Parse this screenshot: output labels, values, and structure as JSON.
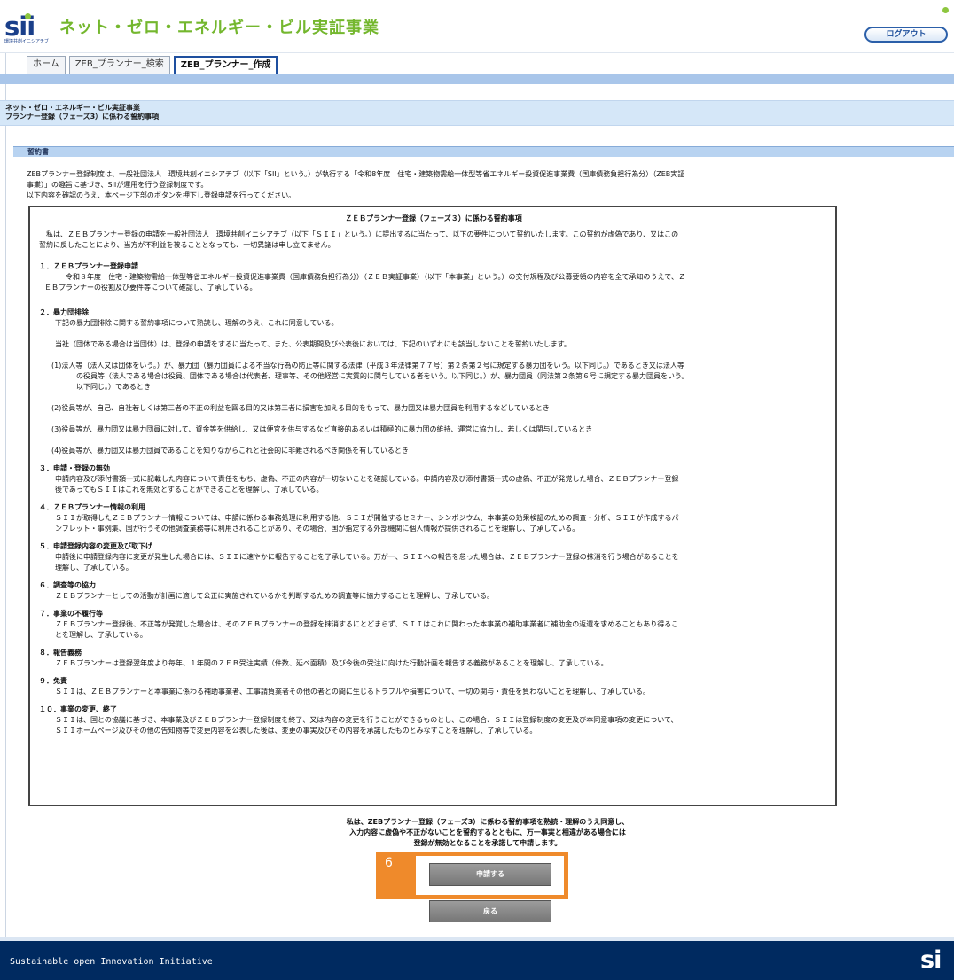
{
  "header": {
    "logo_text": "sii",
    "logo_sub": "環境共創イニシアチブ",
    "site_title": "ネット・ゼロ・エネルギー・ビル実証事業",
    "logout_label": "ログアウト",
    "colors": {
      "logo": "#1a3f8a",
      "title": "#74b72e",
      "accent": "#2b5fa9"
    }
  },
  "tabs": [
    {
      "label": "ホーム",
      "active": false
    },
    {
      "label": "ZEB_プランナー_検索",
      "active": false
    },
    {
      "label": "ZEB_プランナー_作成",
      "active": true
    }
  ],
  "page_title": {
    "line1": "ネット・ゼロ・エネルギー・ビル実証事業",
    "line2": "プランナー登録（フェーズ3）に係わる誓約事項"
  },
  "oath_header": "誓約書",
  "intro": {
    "line1": "ZEBプランナー登録制度は、一般社団法人　環境共創イニシアチブ（以下「SII」という。）が執行する「令和8年度　住宅・建築物需給一体型等省エネルギー投資促進事業費（国庫債務負担行為分）（ZEB実証",
    "line2": "事業）」の趣旨に基づき、SIIが運用を行う登録制度です。",
    "line3": "以下内容を確認のうえ、本ページ下部のボタンを押下し登録申請を行ってください。"
  },
  "terms": {
    "title": "ＺＥＢプランナー登録（フェーズ３）に係わる誓約事項",
    "preamble": [
      "　私は、ＺＥＢプランナー登録の申請を一般社団法人　環境共創イニシアチブ（以下「ＳＩＩ」という。）に提出するに当たって、以下の要件について誓約いたします。この誓約が虚偽であり、又はこの",
      "誓約に反したことにより、当方が不利益を被ることとなっても、一切異議は申し立てません。"
    ],
    "s1_head": "１．ＺＥＢプランナー登録申請",
    "s1_body": [
      "令和８年度　住宅・建築物需給一体型等省エネルギー投資促進事業費（国庫債務負担行為分）（ＺＥＢ実証事業）（以下「本事業」という。）の交付規程及び公募要領の内容を全て承知のうえで、Ｚ",
      "ＥＢプランナーの役割及び要件等について確認し、了承している。"
    ],
    "s2_head": "２．暴力団排除",
    "s2_body1": "下記の暴力団排除に関する誓約事項について熟読し、理解のうえ、これに同意している。",
    "s2_body2": "当社（団体である場合は当団体）は、登録の申請をするに当たって、また、公表期間及び公表後においては、下記のいずれにも該当しないことを誓約いたします。",
    "s2_item1": [
      "(1)法人等（法人又は団体をいう。）が、暴力団（暴力団員による不当な行為の防止等に関する法律（平成３年法律第７７号）第２条第２号に規定する暴力団をいう。以下同じ。）であるとき又は法人等",
      "の役員等（法人である場合は役員、団体である場合は代表者、理事等、その他経営に実質的に関与している者をいう。以下同じ。）が、暴力団員（同法第２条第６号に規定する暴力団員をいう。",
      "以下同じ。）であるとき"
    ],
    "s2_item2": "(2)役員等が、自己、自社若しくは第三者の不正の利益を図る目的又は第三者に損害を加える目的をもって、暴力団又は暴力団員を利用するなどしているとき",
    "s2_item3": "(3)役員等が、暴力団又は暴力団員に対して、資金等を供給し、又は便宜を供与するなど直接的あるいは積極的に暴力団の維持、運営に協力し、若しくは関与しているとき",
    "s2_item4": "(4)役員等が、暴力団又は暴力団員であることを知りながらこれと社会的に非難されるべき関係を有しているとき",
    "s3_head": "３．申請・登録の無効",
    "s3_body": [
      "申請内容及び添付書類一式に記載した内容について責任をもち、虚偽、不正の内容が一切ないことを確認している。申請内容及び添付書類一式の虚偽、不正が発覚した場合、ＺＥＢプランナー登録",
      "後であってもＳＩＩはこれを無効とすることができることを理解し、了承している。"
    ],
    "s4_head": "４．ＺＥＢプランナー情報の利用",
    "s4_body": [
      "ＳＩＩが取得したＺＥＢプランナー情報については、申請に係わる事務処理に利用する他、ＳＩＩが開催するセミナー、シンポジウム、本事業の効果検証のための調査・分析、ＳＩＩが作成するパ",
      "ンフレット・事例集、国が行うその他調査業務等に利用されることがあり、その場合、国が指定する外部機関に個人情報が提供されることを理解し、了承している。"
    ],
    "s5_head": "５．申請登録内容の変更及び取下げ",
    "s5_body": [
      "申請後に申請登録内容に変更が発生した場合には、ＳＩＩに速やかに報告することを了承している。万が一、ＳＩＩへの報告を怠った場合は、ＺＥＢプランナー登録の抹消を行う場合があることを",
      "理解し、了承している。"
    ],
    "s6_head": "６．調査等の協力",
    "s6_body": "ＺＥＢプランナーとしての活動が計画に適して公正に実施されているかを判断するための調査等に協力することを理解し、了承している。",
    "s7_head": "７．事業の不履行等",
    "s7_body": [
      "ＺＥＢプランナー登録後、不正等が発覚した場合は、そのＺＥＢプランナーの登録を抹消するにとどまらず、ＳＩＩはこれに関わった本事業の補助事業者に補助金の返還を求めることもあり得るこ",
      "とを理解し、了承している。"
    ],
    "s8_head": "８．報告義務",
    "s8_body": "ＺＥＢプランナーは登録翌年度より毎年、１年間のＺＥＢ受注実績（件数、延べ面積）及び今後の受注に向けた行動計画を報告する義務があることを理解し、了承している。",
    "s9_head": "９．免責",
    "s9_body": "ＳＩＩは、ＺＥＢプランナーと本事業に係わる補助事業者、工事請負業者その他の者との間に生じるトラブルや損害について、一切の関与・責任を負わないことを理解し、了承している。",
    "s10_head": "１０．事業の変更、終了",
    "s10_body": [
      "ＳＩＩは、国との協議に基づき、本事業及びＺＥＢプランナー登録制度を終了、又は内容の変更を行うことができるものとし、この場合、ＳＩＩは登録制度の変更及び本同意事項の変更について、",
      "ＳＩＩホームページ及びその他の告知物等で変更内容を公表した後は、変更の事実及びその内容を承諾したものとみなすことを理解し、了承している。"
    ]
  },
  "confirm": {
    "line1": "私は、ZEBプランナー登録（フェーズ3）に係わる誓約事項を熟読・理解のうえ同意し、",
    "line2": "入力内容に虚偽や不正がないことを誓約するとともに、万一事実と相違がある場合には",
    "line3": "登録が無効となることを承諾して申請します。"
  },
  "buttons": {
    "apply_label": "申請する",
    "back_label": "戻る"
  },
  "annotation": {
    "step_number": "6",
    "color": "#ef8a2b"
  },
  "footer": {
    "text": "Sustainable open Innovation Initiative",
    "logo_text": "si"
  }
}
